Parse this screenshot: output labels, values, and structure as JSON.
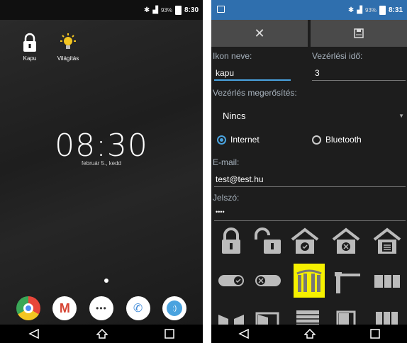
{
  "left": {
    "statusbar": {
      "battery_pct": "93%",
      "time": "8:30"
    },
    "home_icons": [
      {
        "label": "Kapu",
        "icon": "lock-icon"
      },
      {
        "label": "Világítás",
        "icon": "bulb-icon"
      }
    ],
    "clock": {
      "time": "08:30",
      "date": "február 5., kedd"
    },
    "dock": [
      {
        "icon": "chrome-icon",
        "color": "#e8463a"
      },
      {
        "icon": "gmail-icon",
        "color": "#ffffff"
      },
      {
        "icon": "apps-icon",
        "color": "#ffffff"
      },
      {
        "icon": "phone-icon",
        "color": "#3f8ad8"
      },
      {
        "icon": "messages-icon",
        "color": "#4aa3df"
      }
    ]
  },
  "right": {
    "statusbar": {
      "battery_pct": "93%",
      "time": "8:31"
    },
    "toolbar": {
      "cancel_icon": "close-icon",
      "save_icon": "save-icon"
    },
    "form": {
      "icon_name_label": "Ikon neve:",
      "icon_name_value": "kapu",
      "control_time_label": "Vezérlési idő:",
      "control_time_value": "3",
      "confirm_label": "Vezérlés megerősítés:",
      "confirm_value": "Nincs",
      "radio_internet": "Internet",
      "radio_bluetooth": "Bluetooth",
      "email_label": "E-mail:",
      "email_value": "test@test.hu",
      "password_label": "Jelszó:",
      "password_value": "••••"
    },
    "accent": "#4aa3df",
    "icon_grid_selected": "gate-icon"
  }
}
